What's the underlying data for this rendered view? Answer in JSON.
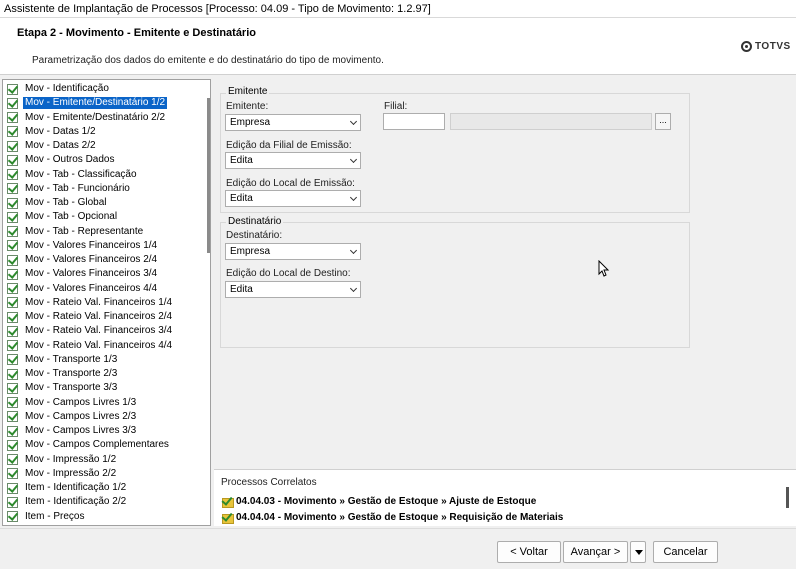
{
  "window": {
    "title": "Assistente de Implantação de Processos [Processo: 04.09 - Tipo de Movimento: 1.2.97]"
  },
  "header": {
    "step_title": "Etapa 2 - Movimento - Emitente e Destinatário",
    "subtitle": "Parametrização dos dados do emitente e do destinatário do tipo de movimento.",
    "logo_text": "TOTVS"
  },
  "steps": [
    "Mov - Identificação",
    "Mov - Emitente/Destinatário 1/2",
    "Mov - Emitente/Destinatário 2/2",
    "Mov - Datas 1/2",
    "Mov - Datas 2/2",
    "Mov - Outros Dados",
    "Mov - Tab - Classificação",
    "Mov - Tab - Funcionário",
    "Mov - Tab - Global",
    "Mov - Tab - Opcional",
    "Mov - Tab - Representante",
    "Mov - Valores Financeiros 1/4",
    "Mov - Valores Financeiros 2/4",
    "Mov - Valores Financeiros 3/4",
    "Mov - Valores Financeiros 4/4",
    "Mov - Rateio Val. Financeiros 1/4",
    "Mov - Rateio Val. Financeiros 2/4",
    "Mov - Rateio Val. Financeiros 3/4",
    "Mov - Rateio Val. Financeiros 4/4",
    "Mov - Transporte 1/3",
    "Mov - Transporte 2/3",
    "Mov - Transporte 3/3",
    "Mov - Campos Livres 1/3",
    "Mov - Campos Livres 2/3",
    "Mov - Campos Livres 3/3",
    "Mov - Campos Complementares",
    "Mov - Impressão 1/2",
    "Mov - Impressão 2/2",
    "Item - Identificação 1/2",
    "Item - Identificação 2/2",
    "Item - Preços"
  ],
  "selected_step_index": 1,
  "emitente": {
    "legend": "Emitente",
    "emitente_label": "Emitente:",
    "emitente_value": "Empresa",
    "filial_label": "Filial:",
    "filial_button": "...",
    "edicao_filial_label": "Edição da Filial de Emissão:",
    "edicao_filial_value": "Edita",
    "edicao_local_label": "Edição do Local de Emissão:",
    "edicao_local_value": "Edita"
  },
  "destinatario": {
    "legend": "Destinatário",
    "destinatario_label": "Destinatário:",
    "destinatario_value": "Empresa",
    "edicao_local_label": "Edição do Local de Destino:",
    "edicao_local_value": "Edita"
  },
  "correlated": {
    "title": "Processos Correlatos",
    "items": [
      "04.04.03 - Movimento » Gestão de Estoque » Ajuste de Estoque",
      "04.04.04 - Movimento » Gestão de Estoque » Requisição de Materiais"
    ]
  },
  "footer": {
    "back_label": "< Voltar",
    "next_label": "Avançar >",
    "cancel_label": "Cancelar"
  }
}
